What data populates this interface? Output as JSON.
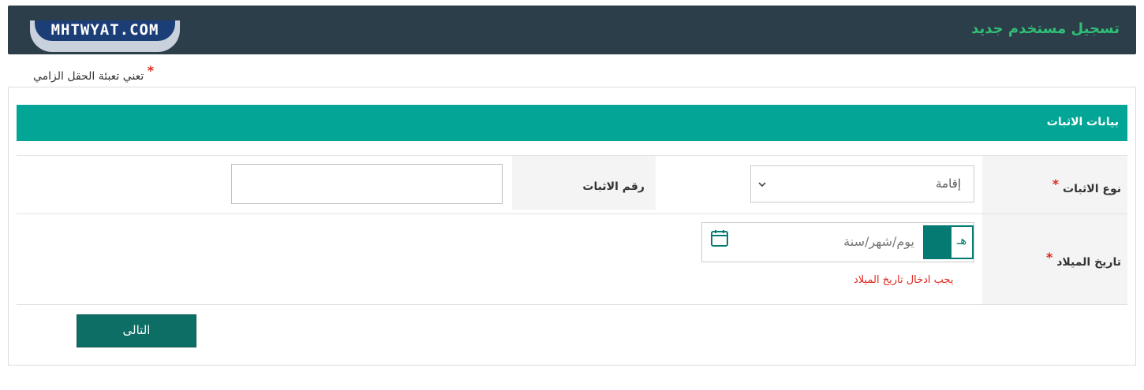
{
  "header": {
    "title": "تسجيل مستخدم جديد",
    "logo_text": "MHTWYAT.COM"
  },
  "required_note": {
    "star": "*",
    "text": "تعني تعبئة الحقل الزامي"
  },
  "section": {
    "title": "بيانات الاثبات"
  },
  "fields": {
    "id_type": {
      "label": "نوع الاثبات",
      "star": "*",
      "selected": "إقامة"
    },
    "id_number": {
      "label": "رقم الاثبات",
      "value": ""
    },
    "birth_date": {
      "label": "تاريخ الميلاد",
      "star": "*",
      "placeholder": "يوم/شهر/سنة",
      "calendar_toggle": "هـ",
      "error": "يجب ادخال تاريخ الميلاد"
    }
  },
  "actions": {
    "next_label": "التالى"
  },
  "colors": {
    "header_bg": "#2c3e4a",
    "header_title": "#2fbf74",
    "section_bar": "#03a696",
    "button": "#0d6e66",
    "error": "#e1261c"
  },
  "icons": {
    "select_arrow": "chevron-down-icon",
    "calendar": "calendar-icon"
  }
}
